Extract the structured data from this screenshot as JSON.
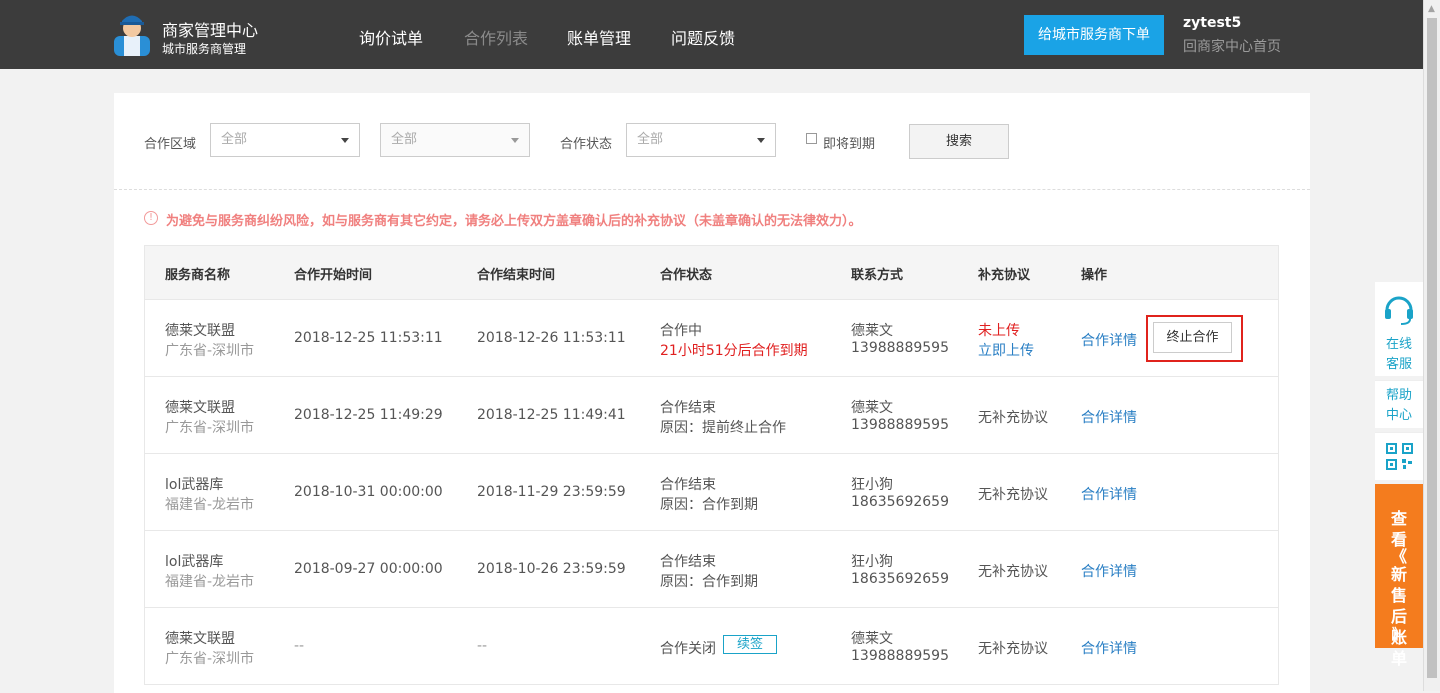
{
  "header": {
    "brand_title": "商家管理中心",
    "brand_sub": "城市服务商管理",
    "nav": [
      "询价试单",
      "合作列表",
      "账单管理",
      "问题反馈"
    ],
    "order_button": "给城市服务商下单",
    "user_name": "zytest5",
    "user_back": "回商家中心首页"
  },
  "filters": {
    "region_label": "合作区域",
    "region_value": "全部",
    "city_value": "全部",
    "status_label": "合作状态",
    "status_value": "全部",
    "expiring_label": "即将到期",
    "search_button": "搜索"
  },
  "notice": "为避免与服务商纠纷风险，如与服务商有其它约定，请务必上传双方盖章确认后的补充协议（未盖章确认的无法律效力）。",
  "table": {
    "headers": [
      "服务商名称",
      "合作开始时间",
      "合作结束时间",
      "合作状态",
      "联系方式",
      "补充协议",
      "操作"
    ],
    "rows": [
      {
        "name": "德莱文联盟",
        "region": "广东省-深圳市",
        "start": "2018-12-25 11:53:11",
        "end": "2018-12-26 11:53:11",
        "status": "合作中",
        "status_sub": "21小时51分后合作到期",
        "contact": "德莱文",
        "phone": "13988889595",
        "agreement": "未上传",
        "agreement_link": "立即上传",
        "detail": "合作详情",
        "terminate": "终止合作"
      },
      {
        "name": "德莱文联盟",
        "region": "广东省-深圳市",
        "start": "2018-12-25 11:49:29",
        "end": "2018-12-25 11:49:41",
        "status": "合作结束",
        "status_sub": "原因：提前终止合作",
        "contact": "德莱文",
        "phone": "13988889595",
        "agreement": "无补充协议",
        "detail": "合作详情"
      },
      {
        "name": "lol武器库",
        "region": "福建省-龙岩市",
        "start": "2018-10-31 00:00:00",
        "end": "2018-11-29 23:59:59",
        "status": "合作结束",
        "status_sub": "原因：合作到期",
        "contact": "狂小狗",
        "phone": "18635692659",
        "agreement": "无补充协议",
        "detail": "合作详情"
      },
      {
        "name": "lol武器库",
        "region": "福建省-龙岩市",
        "start": "2018-09-27 00:00:00",
        "end": "2018-10-26 23:59:59",
        "status": "合作结束",
        "status_sub": "原因：合作到期",
        "contact": "狂小狗",
        "phone": "18635692659",
        "agreement": "无补充协议",
        "detail": "合作详情"
      },
      {
        "name": "德莱文联盟",
        "region": "广东省-深圳市",
        "start": "--",
        "end": "--",
        "status": "合作关闭",
        "renew": "续签",
        "contact": "德莱文",
        "phone": "13988889595",
        "agreement": "无补充协议",
        "detail": "合作详情"
      }
    ]
  },
  "sidebar": {
    "service_l1": "在线",
    "service_l2": "客服",
    "help_l1": "帮助",
    "help_l2": "中心",
    "promo_chars": [
      "查",
      "看",
      "《",
      "新",
      "售",
      "后",
      "账",
      "单",
      "》"
    ]
  },
  "colors": {
    "topbar": "#3c3c3c",
    "accent_blue": "#1aa3e6",
    "link": "#2a7fc4",
    "warning": "#f0807f",
    "alert_red": "#e02020",
    "promo_orange": "#f47c1e"
  }
}
